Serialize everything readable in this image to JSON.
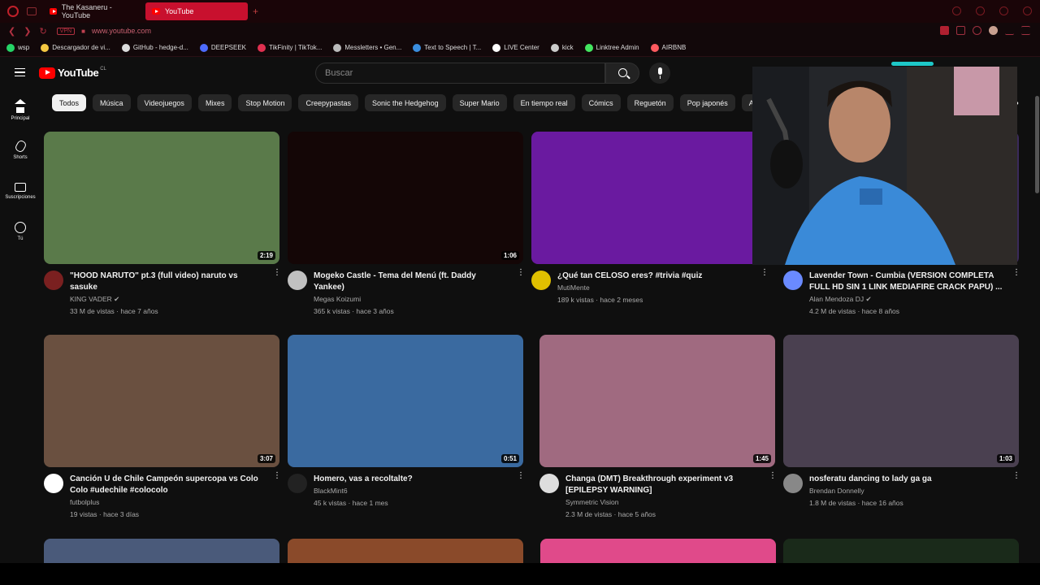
{
  "browser": {
    "tabs": [
      {
        "label": "The Kasaneru - YouTube"
      },
      {
        "label": "YouTube"
      }
    ],
    "new_tab": "+",
    "vpn": "VPN",
    "url": "www.youtube.com"
  },
  "bookmarks": [
    {
      "label": "wsp",
      "color": "#25d366"
    },
    {
      "label": "Descargador de vi...",
      "color": "#f5c842"
    },
    {
      "label": "GitHub - hedge-d...",
      "color": "#dddddd"
    },
    {
      "label": "DEEPSEEK",
      "color": "#4d6bfe"
    },
    {
      "label": "TikFinity | TikTok...",
      "color": "#e03050"
    },
    {
      "label": "Messletters • Gen...",
      "color": "#bbbbbb"
    },
    {
      "label": "Text to Speech | T...",
      "color": "#3a8dde"
    },
    {
      "label": "LIVE Center",
      "color": "#ffffff"
    },
    {
      "label": "kick",
      "color": "#cccccc"
    },
    {
      "label": "Linktree Admin",
      "color": "#43e660"
    },
    {
      "label": "AIRBNB",
      "color": "#ff5a5f"
    }
  ],
  "header": {
    "logo_text": "YouTube",
    "country": "CL",
    "search_placeholder": "Buscar"
  },
  "sidebar": [
    {
      "label": "Principal",
      "icon": "home-icon"
    },
    {
      "label": "Shorts",
      "icon": "shorts-icon"
    },
    {
      "label": "Suscripciones",
      "icon": "subscriptions-icon"
    },
    {
      "label": "Tú",
      "icon": "you-icon"
    }
  ],
  "chips": [
    "Todos",
    "Música",
    "Videojuegos",
    "Mixes",
    "Stop Motion",
    "Creepypastas",
    "Sonic the Hedgehog",
    "Super Mario",
    "En tiempo real",
    "Cómics",
    "Reguetón",
    "Pop japonés",
    "A"
  ],
  "videos": [
    {
      "title": "\"HOOD NARUTO\" pt.3 (full video) naruto vs sasuke",
      "channel": "KING VADER ✔",
      "stats": "33 M de vistas · hace 7 años",
      "duration": "2:19",
      "thumb": "#5a7a4a",
      "avatar": "#7a2020"
    },
    {
      "title": "Mogeko Castle - Tema del Menú (ft. Daddy Yankee)",
      "channel": "Megas Koizumi",
      "stats": "365 k vistas · hace 3 años",
      "duration": "1:06",
      "thumb": "#140606",
      "avatar": "#c0c0c0"
    },
    {
      "title": "¿Qué tan CELOSO eres? #trivia #quiz",
      "channel": "MutiMente",
      "stats": "189 k vistas · hace 2 meses",
      "duration": "",
      "thumb": "#6a1aa0",
      "avatar": "#e0c000"
    },
    {
      "title": "Lavender Town - Cumbia (VERSION COMPLETA FULL HD SIN 1 LINK MEDIAFIRE CRACK PAPU) ...",
      "channel": "Alan Mendoza DJ ✔",
      "stats": "4.2 M de vistas · hace 8 años",
      "duration": "",
      "thumb": "#3a2a5a",
      "avatar": "#6a8aff"
    },
    {
      "title": "Canción U de Chile Campeón supercopa vs Colo Colo #udechile #colocolo",
      "channel": "futbolplus",
      "stats": "19 vistas · hace 3 días",
      "duration": "3:07",
      "thumb": "#6a5040",
      "avatar": "#ffffff"
    },
    {
      "title": "Homero, vas a recoltalte?",
      "channel": "BlackMint6",
      "stats": "45 k vistas · hace 1 mes",
      "duration": "0:51",
      "thumb": "#3a6aa0",
      "avatar": "#222222"
    },
    {
      "title": "Changa (DMT) Breakthrough experiment v3 [EPILEPSY WARNING]",
      "channel": "Symmetric Vision",
      "stats": "2.3 M de vistas · hace 5 años",
      "duration": "1:45",
      "thumb": "#a06a80",
      "avatar": "#dddddd"
    },
    {
      "title": "nosferatu dancing to lady ga ga",
      "channel": "Brendan Donnelly",
      "stats": "1.8 M de vistas · hace 16 años",
      "duration": "1:03",
      "thumb": "#4a4050",
      "avatar": "#888888"
    }
  ],
  "partial_thumbs": [
    "#4a5a7a",
    "#8a4a2a",
    "#e04a8a",
    "#1a2a1a"
  ],
  "colors": {
    "accent": "#ff0000",
    "browser_accent": "#c8102e",
    "bg": "#0f0f0f"
  }
}
